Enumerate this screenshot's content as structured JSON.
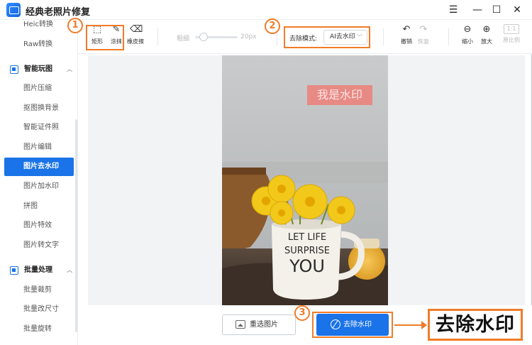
{
  "app": {
    "title": "经典老照片修复"
  },
  "window": {
    "menu_icon": "menu-icon",
    "minimize_icon": "minimize-icon",
    "maximize_icon": "maximize-icon",
    "close_icon": "close-icon"
  },
  "sidebar": {
    "items_top": [
      {
        "label": "Heic转换"
      },
      {
        "label": "Raw转换"
      }
    ],
    "section_smart": {
      "label": "智能玩图"
    },
    "items_smart": [
      {
        "label": "图片压缩"
      },
      {
        "label": "抠图换背景"
      },
      {
        "label": "智能证件照"
      },
      {
        "label": "图片编辑"
      },
      {
        "label": "图片去水印",
        "active": true
      },
      {
        "label": "图片加水印"
      },
      {
        "label": "拼图"
      },
      {
        "label": "图片特效"
      },
      {
        "label": "图片转文字"
      }
    ],
    "section_batch": {
      "label": "批量处理"
    },
    "items_batch": [
      {
        "label": "批量裁剪"
      },
      {
        "label": "批量改尺寸"
      },
      {
        "label": "批量旋转"
      }
    ]
  },
  "toolbar": {
    "rect": {
      "label": "矩形"
    },
    "smear": {
      "label": "涂抹"
    },
    "eraser": {
      "label": "橡皮擦"
    },
    "brush": {
      "label": "粗细",
      "size": "20px",
      "level": 0.1
    },
    "mode": {
      "label": "去除模式:",
      "value": "AI去水印"
    },
    "undo": {
      "label": "撤销"
    },
    "redo": {
      "label": "恢复"
    },
    "zoom_out": {
      "label": "缩小"
    },
    "zoom_in": {
      "label": "放大"
    },
    "original": {
      "label": "原比例",
      "ratio": "1:1"
    }
  },
  "annotations": {
    "step1": "1",
    "step2": "2",
    "step3": "3",
    "callout": "去除水印"
  },
  "image": {
    "watermark_text": "我是水印",
    "mug_lines": [
      "LET LIFE",
      "SURPRISE",
      "YOU"
    ]
  },
  "bottom": {
    "reselect_label": "重选图片",
    "remove_label": "去除水印"
  },
  "colors": {
    "accent": "#1a73e8",
    "annotation": "#f07c2a",
    "watermark_bg": "#e78a84"
  }
}
